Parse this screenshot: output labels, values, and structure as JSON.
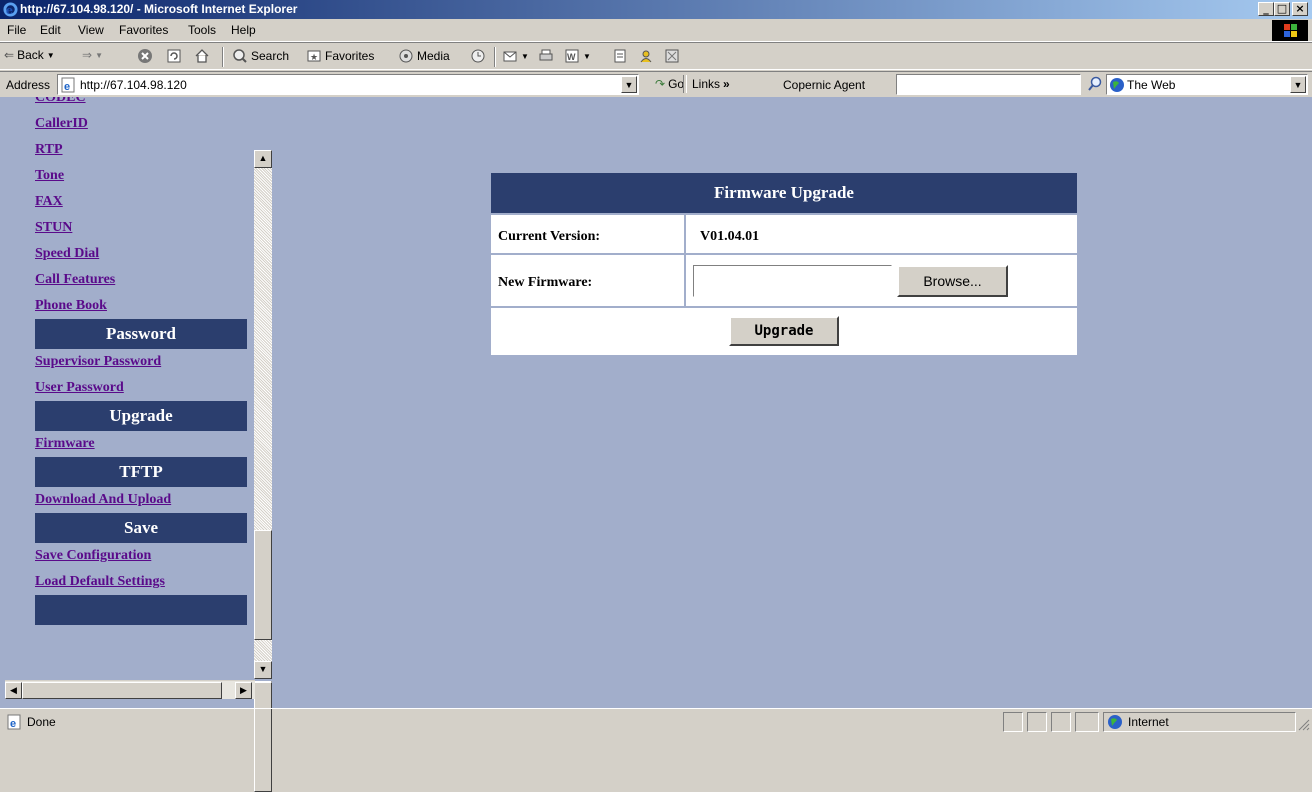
{
  "window": {
    "title": "http://67.104.98.120/ - Microsoft Internet Explorer"
  },
  "menu": [
    "File",
    "Edit",
    "View",
    "Favorites",
    "Tools",
    "Help"
  ],
  "toolbar": {
    "back": "Back",
    "search": "Search",
    "favorites": "Favorites",
    "media": "Media"
  },
  "address": {
    "label": "Address",
    "url": "http://67.104.98.120",
    "go": "Go",
    "links": "Links",
    "agent_label": "Copernic Agent",
    "agent_value": "",
    "scope": "The Web"
  },
  "nav": {
    "top_links": [
      "CODEC",
      "CallerID",
      "RTP",
      "Tone",
      "FAX",
      "STUN",
      "Speed Dial",
      "Call Features",
      "Phone Book"
    ],
    "password_heading": "Password",
    "password_links": [
      "Supervisor Password",
      "User Password"
    ],
    "upgrade_heading": "Upgrade",
    "upgrade_links": [
      "Firmware"
    ],
    "tftp_heading": "TFTP",
    "tftp_links": [
      "Download And Upload"
    ],
    "save_heading": "Save",
    "save_links": [
      "Save Configuration",
      "Load Default Settings"
    ]
  },
  "firmware": {
    "heading": "Firmware Upgrade",
    "current_label": "Current Version:",
    "current_value": "V01.04.01",
    "new_label": "New Firmware:",
    "file_value": "",
    "browse": "Browse...",
    "upgrade": "Upgrade"
  },
  "status": {
    "text": "Done",
    "zone": "Internet"
  }
}
